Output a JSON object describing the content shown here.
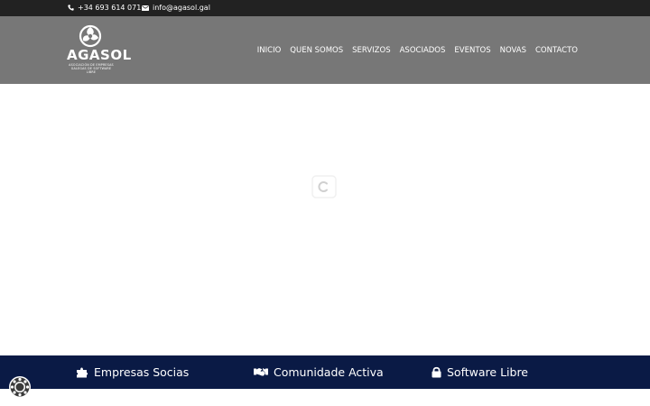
{
  "topbar": {
    "phone": "+34 693 614 071",
    "email": "info@agasol.gal",
    "phone_icon": "phone-icon",
    "email_icon": "envelope-icon"
  },
  "logo": {
    "name": "AGASOL",
    "tagline": "ASOCIACIÓN DE EMPRESAS GALEGAS DE SOFTWARE LIBRE"
  },
  "nav": {
    "items": [
      "INICIO",
      "QUEN SOMOS",
      "SERVIZOS",
      "ASOCIADOS",
      "EVENTOS",
      "NOVAS",
      "CONTACTO"
    ]
  },
  "features": [
    {
      "label": "Empresas Socias",
      "icon": "puzzle-icon"
    },
    {
      "label": "Comunidade Activa",
      "icon": "handshake-icon"
    },
    {
      "label": "Software Libre",
      "icon": "lock-icon"
    }
  ],
  "colors": {
    "topbar": "#222222",
    "header": "#777777",
    "features_band": "#0a1a45"
  }
}
